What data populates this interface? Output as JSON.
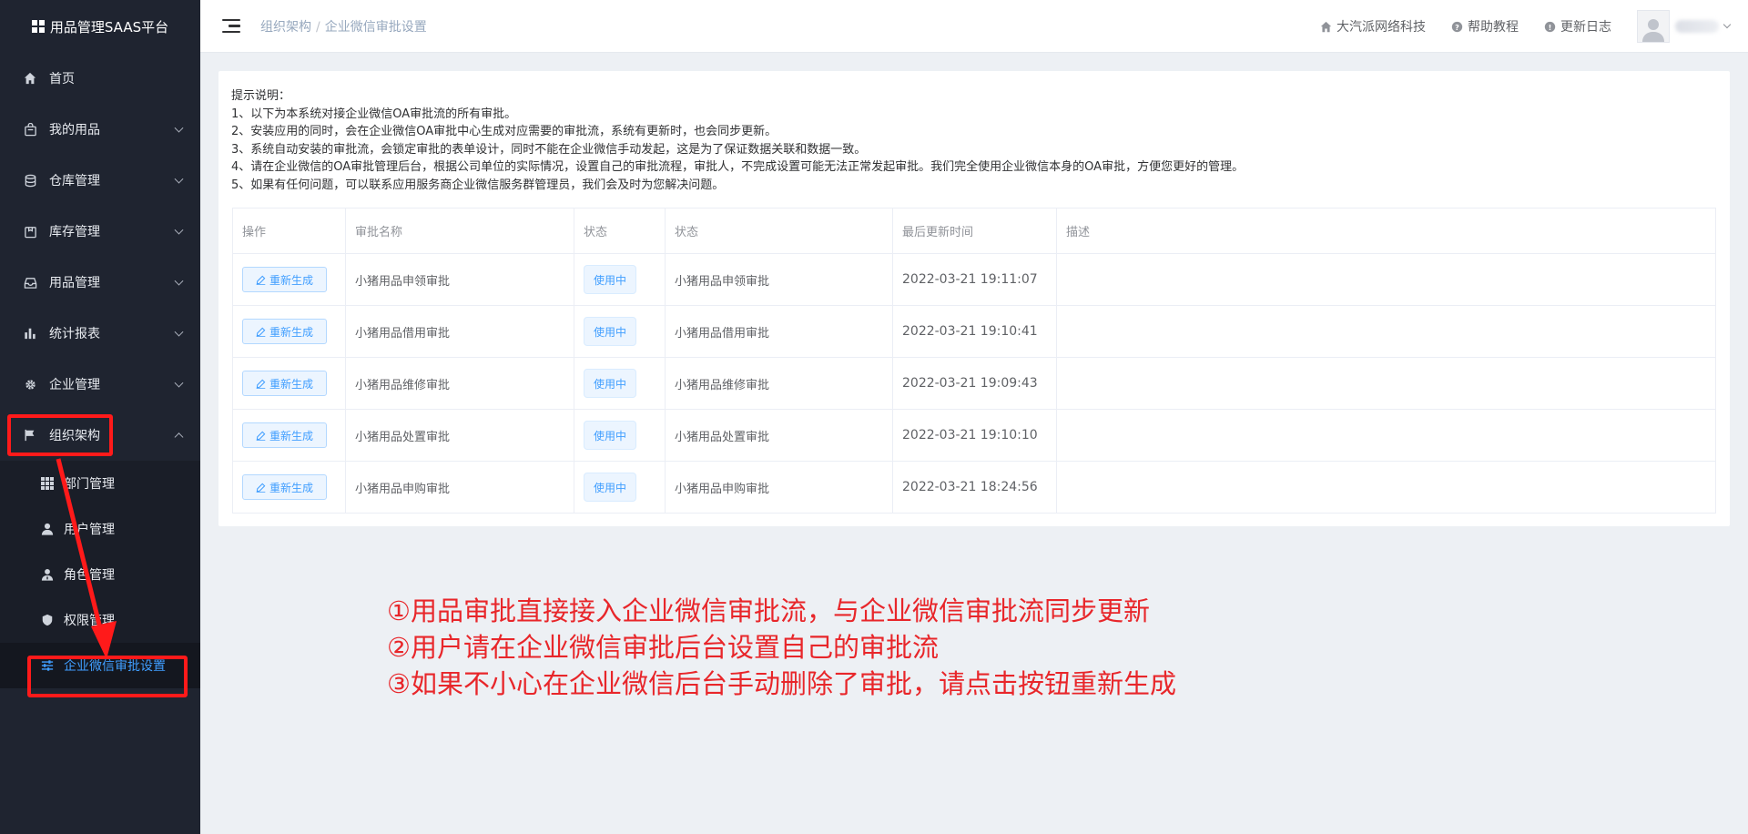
{
  "app": {
    "title": "用品管理SAAS平台"
  },
  "sidebar": {
    "items": [
      {
        "label": "首页",
        "icon": "home-icon",
        "has_children": false
      },
      {
        "label": "我的用品",
        "icon": "bag-icon",
        "has_children": true
      },
      {
        "label": "仓库管理",
        "icon": "database-icon",
        "has_children": true
      },
      {
        "label": "库存管理",
        "icon": "box-icon",
        "has_children": true
      },
      {
        "label": "用品管理",
        "icon": "inbox-icon",
        "has_children": true
      },
      {
        "label": "统计报表",
        "icon": "bar-chart-icon",
        "has_children": true
      },
      {
        "label": "企业管理",
        "icon": "gear-icon",
        "has_children": true
      },
      {
        "label": "组织架构",
        "icon": "flag-icon",
        "has_children": true,
        "expanded": true
      }
    ],
    "sub_items": [
      {
        "label": "部门管理",
        "icon": "grid-icon"
      },
      {
        "label": "用户管理",
        "icon": "user-icon"
      },
      {
        "label": "角色管理",
        "icon": "user-role-icon"
      },
      {
        "label": "权限管理",
        "icon": "shield-icon"
      },
      {
        "label": "企业微信审批设置",
        "icon": "sliders-icon",
        "active": true
      }
    ]
  },
  "header": {
    "breadcrumb": [
      "组织架构",
      "企业微信审批设置"
    ],
    "links": [
      {
        "label": "大汽派网络科技",
        "icon": "home-icon"
      },
      {
        "label": "帮助教程",
        "icon": "help-icon"
      },
      {
        "label": "更新日志",
        "icon": "info-icon"
      }
    ]
  },
  "tips": {
    "title": "提示说明：",
    "lines": [
      "1、以下为本系统对接企业微信OA审批流的所有审批。",
      "2、安装应用的同时，会在企业微信OA审批中心生成对应需要的审批流，系统有更新时，也会同步更新。",
      "3、系统自动安装的审批流，会锁定审批的表单设计，同时不能在企业微信手动发起，这是为了保证数据关联和数据一致。",
      "4、请在企业微信的OA审批管理后台，根据公司单位的实际情况，设置自己的审批流程，审批人，不完成设置可能无法正常发起审批。我们完全使用企业微信本身的OA审批，方便您更好的管理。",
      "5、如果有任何问题，可以联系应用服务商企业微信服务群管理员，我们会及时为您解决问题。"
    ]
  },
  "table": {
    "columns": [
      "操作",
      "审批名称",
      "状态",
      "状态",
      "最后更新时间",
      "描述"
    ],
    "button_label": "重新生成",
    "rows": [
      {
        "name": "小猪用品申领审批",
        "tag": "使用中",
        "status": "小猪用品申领审批",
        "time": "2022-03-21 19:11:07",
        "desc": ""
      },
      {
        "name": "小猪用品借用审批",
        "tag": "使用中",
        "status": "小猪用品借用审批",
        "time": "2022-03-21 19:10:41",
        "desc": ""
      },
      {
        "name": "小猪用品维修审批",
        "tag": "使用中",
        "status": "小猪用品维修审批",
        "time": "2022-03-21 19:09:43",
        "desc": ""
      },
      {
        "name": "小猪用品处置审批",
        "tag": "使用中",
        "status": "小猪用品处置审批",
        "time": "2022-03-21 19:10:10",
        "desc": ""
      },
      {
        "name": "小猪用品申购审批",
        "tag": "使用中",
        "status": "小猪用品申购审批",
        "time": "2022-03-21 18:24:56",
        "desc": ""
      }
    ]
  },
  "annotations": {
    "color": "#e8262a",
    "lines": [
      "①用品审批直接接入企业微信审批流，与企业微信审批流同步更新",
      "②用户请在企业微信审批后台设置自己的审批流",
      "③如果不小心在企业微信后台手动删除了审批，请点击按钮重新生成"
    ]
  }
}
